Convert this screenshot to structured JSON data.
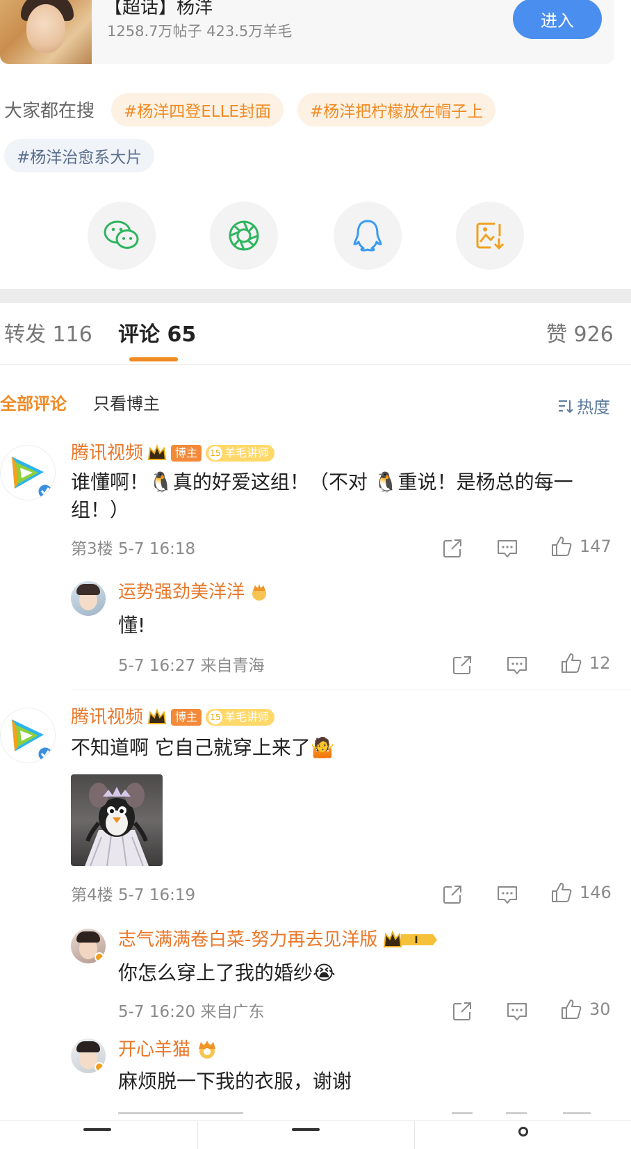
{
  "topic": {
    "title": "【超话】杨洋",
    "stats": "1258.7万帖子 423.5万羊毛",
    "enter_label": "进入"
  },
  "searches": {
    "label": "大家都在搜",
    "items": [
      "#杨洋四登ELLE封面",
      "#杨洋把柠檬放在帽子上",
      "#杨洋治愈系大片"
    ]
  },
  "share": {
    "icons": [
      "wechat-icon",
      "moments-icon",
      "qq-icon",
      "save-image-icon"
    ]
  },
  "tabs": {
    "repost": "转发 116",
    "comment": "评论 65",
    "like": "赞 926"
  },
  "filters": {
    "all": "全部评论",
    "blogger_only": "只看博主",
    "sort": "热度"
  },
  "comments": [
    {
      "user": "腾讯视频",
      "badge_owner": "博主",
      "badge_level": "15",
      "badge_title": "羊毛讲师",
      "text": "谁懂啊！🐧真的好爱这组！（不对 🐧重说！是杨总的每一组！）",
      "floor_time": "第3楼 5-7 16:18",
      "likes": "147",
      "replies": [
        {
          "user": "运势强劲美洋洋",
          "text": "懂!",
          "meta": "5-7 16:27 来自青海",
          "likes": "12"
        }
      ]
    },
    {
      "user": "腾讯视频",
      "badge_owner": "博主",
      "badge_level": "15",
      "badge_title": "羊毛讲师",
      "text": "不知道啊 它自己就穿上来了🤷",
      "floor_time": "第4楼 5-7 16:19",
      "likes": "146",
      "replies": [
        {
          "user": "志气满满卷白菜-努力再去见洋版",
          "text": "你怎么穿上了我的婚纱😭",
          "meta": "5-7 16:20 来自广东",
          "likes": "30"
        },
        {
          "user": "开心羊猫",
          "text": "麻烦脱一下我的衣服，谢谢"
        }
      ]
    }
  ],
  "colors": {
    "accent_orange": "#f08a23",
    "username_orange": "#e9772a",
    "enter_blue": "#4a8ef0"
  }
}
